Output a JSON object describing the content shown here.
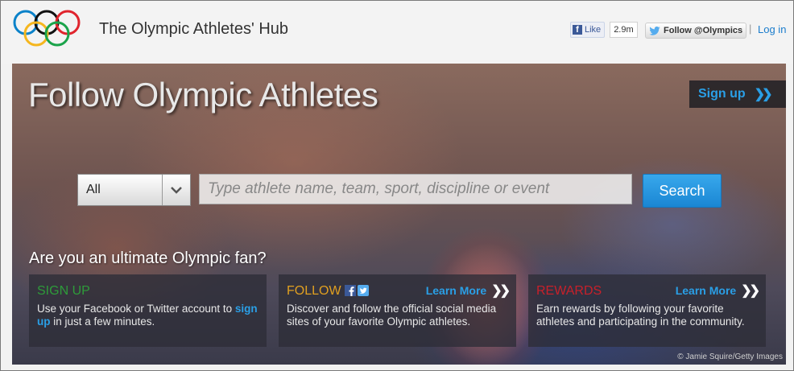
{
  "header": {
    "site_title": "The Olympic Athletes' Hub",
    "fb_like_label": "Like",
    "fb_like_count": "2.9m",
    "twitter_follow_label": "Follow @Olympics",
    "separator": "|",
    "login_label": "Log in"
  },
  "hero": {
    "title": "Follow Olympic Athletes",
    "signup_label": "Sign up",
    "credit": "© Jamie Squire/Getty Images"
  },
  "search": {
    "category_value": "All",
    "placeholder": "Type athlete name, team, sport, discipline or event",
    "button_label": "Search"
  },
  "fan": {
    "question": "Are you an ultimate Olympic fan?",
    "panels": [
      {
        "title": "SIGN UP",
        "title_color": "#2e9b3a",
        "desc_before": "Use your Facebook or Twitter account to ",
        "desc_link": "sign up",
        "desc_after": " in just a few minutes."
      },
      {
        "title": "FOLLOW",
        "title_color": "#e0a020",
        "learn_more": "Learn More",
        "desc": "Discover and follow the official social media sites of your favorite Olympic athletes."
      },
      {
        "title": "REWARDS",
        "title_color": "#c8202a",
        "learn_more": "Learn More",
        "desc": "Earn rewards by following your favorite athletes and participating in the community."
      }
    ]
  },
  "colors": {
    "accent_blue": "#2a9fe6",
    "facebook": "#3b5998",
    "twitter": "#55acee"
  },
  "icons": [
    "olympic-rings-logo",
    "facebook-icon",
    "twitter-bird-icon",
    "chevron-down-icon",
    "double-chevron-right-icon"
  ]
}
